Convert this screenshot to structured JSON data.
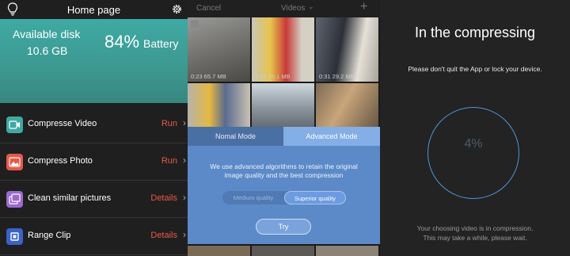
{
  "home": {
    "title": "Home page",
    "icons": {
      "left": "lightbulb-icon",
      "right": "gear-icon"
    },
    "disk_label": "Available disk",
    "disk_value": "10.6 GB",
    "battery_percent": "84%",
    "battery_label": "Battery",
    "items": [
      {
        "label": "Compresse Video",
        "action": "Run",
        "icon": "video-icon",
        "color": "#3fa9a3"
      },
      {
        "label": "Compress Photo",
        "action": "Run",
        "icon": "photo-icon",
        "color": "#e8584a"
      },
      {
        "label": "Clean similar pictures",
        "action": "Details",
        "icon": "similar-pictures-icon",
        "color": "#9b6ad0"
      },
      {
        "label": "Range Clip",
        "action": "Details",
        "icon": "range-clip-icon",
        "color": "#3a62c8"
      }
    ]
  },
  "videos": {
    "cancel": "Cancel",
    "title": "Videos",
    "thumbs": [
      {
        "caption": "0:23 65.7 MB"
      },
      {
        "caption": "1:05 96.1 MB"
      },
      {
        "caption": "0:31 29.2 MB"
      }
    ],
    "modes": {
      "nomal": "Nomal Mode",
      "advanced": "Advanced Mode"
    },
    "description": "We use advanced algorithms to retain the original image quality and the best compression",
    "quality": {
      "medium": "Medium quality",
      "superior": "Superior quality"
    },
    "try_label": "Try"
  },
  "compress": {
    "title": "In the compressing",
    "warning": "Please don't quit the App or lock your device.",
    "progress": "4%",
    "info_line1": "Your choosing video is in compression.",
    "info_line2": "This may take a while, please wait."
  }
}
